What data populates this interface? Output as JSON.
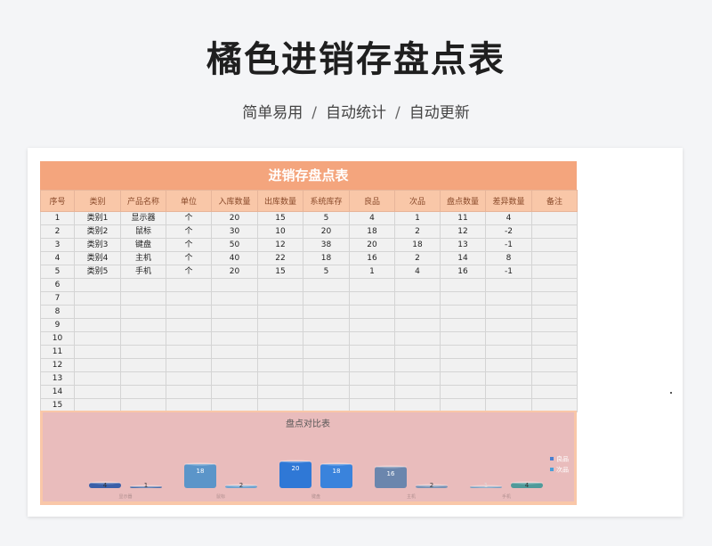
{
  "header": {
    "title": "橘色进销存盘点表",
    "subtitle": [
      "简单易用",
      "自动统计",
      "自动更新"
    ],
    "separator": "/"
  },
  "sheet": {
    "title": "进销存盘点表",
    "columns": [
      "序号",
      "类别",
      "产品名称",
      "单位",
      "入库数量",
      "出库数量",
      "系统库存",
      "良品",
      "次品",
      "盘点数量",
      "差异数量",
      "备注"
    ],
    "rows": [
      [
        "1",
        "类别1",
        "显示器",
        "个",
        "20",
        "15",
        "5",
        "4",
        "1",
        "11",
        "4",
        ""
      ],
      [
        "2",
        "类别2",
        "鼠标",
        "个",
        "30",
        "10",
        "20",
        "18",
        "2",
        "12",
        "-2",
        ""
      ],
      [
        "3",
        "类别3",
        "键盘",
        "个",
        "50",
        "12",
        "38",
        "20",
        "18",
        "13",
        "-1",
        ""
      ],
      [
        "4",
        "类别4",
        "主机",
        "个",
        "40",
        "22",
        "18",
        "16",
        "2",
        "14",
        "8",
        ""
      ],
      [
        "5",
        "类别5",
        "手机",
        "个",
        "20",
        "15",
        "5",
        "1",
        "4",
        "16",
        "-1",
        ""
      ],
      [
        "6",
        "",
        "",
        "",
        "",
        "",
        "",
        "",
        "",
        "",
        "",
        ""
      ],
      [
        "7",
        "",
        "",
        "",
        "",
        "",
        "",
        "",
        "",
        "",
        "",
        ""
      ],
      [
        "8",
        "",
        "",
        "",
        "",
        "",
        "",
        "",
        "",
        "",
        "",
        ""
      ],
      [
        "9",
        "",
        "",
        "",
        "",
        "",
        "",
        "",
        "",
        "",
        "",
        ""
      ],
      [
        "10",
        "",
        "",
        "",
        "",
        "",
        "",
        "",
        "",
        "",
        "",
        ""
      ],
      [
        "11",
        "",
        "",
        "",
        "",
        "",
        "",
        "",
        "",
        "",
        "",
        ""
      ],
      [
        "12",
        "",
        "",
        "",
        "",
        "",
        "",
        "",
        "",
        "",
        "",
        ""
      ],
      [
        "13",
        "",
        "",
        "",
        "",
        "",
        "",
        "",
        "",
        "",
        "",
        ""
      ],
      [
        "14",
        "",
        "",
        "",
        "",
        "",
        "",
        "",
        "",
        "",
        "",
        ""
      ],
      [
        "15",
        "",
        "",
        "",
        "",
        "",
        "",
        "",
        "",
        "",
        "",
        ""
      ]
    ]
  },
  "chart_data": {
    "type": "bar",
    "title": "盘点对比表",
    "categories": [
      "显示器",
      "鼠标",
      "键盘",
      "主机",
      "手机"
    ],
    "series": [
      {
        "name": "良品",
        "values": [
          4,
          18,
          20,
          16,
          1
        ],
        "colors": [
          "#3a5fa8",
          "#5b95c9",
          "#2f78d6",
          "#6b86ad",
          "#7c9fbf"
        ]
      },
      {
        "name": "次品",
        "values": [
          1,
          2,
          18,
          2,
          4
        ],
        "colors": [
          "#4f6fa8",
          "#6fa3cf",
          "#3a83dc",
          "#7a93b5",
          "#4f9a9a"
        ]
      }
    ],
    "ylim": [
      0,
      20
    ],
    "legend": "right"
  }
}
